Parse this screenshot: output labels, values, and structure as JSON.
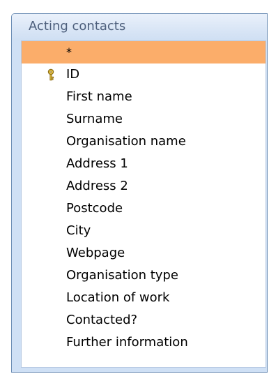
{
  "table": {
    "title": "Acting contacts",
    "fields": [
      {
        "label": "*",
        "selected": true,
        "primary_key": false
      },
      {
        "label": "ID",
        "selected": false,
        "primary_key": true
      },
      {
        "label": "First name",
        "selected": false,
        "primary_key": false
      },
      {
        "label": "Surname",
        "selected": false,
        "primary_key": false
      },
      {
        "label": "Organisation name",
        "selected": false,
        "primary_key": false
      },
      {
        "label": "Address 1",
        "selected": false,
        "primary_key": false
      },
      {
        "label": "Address 2",
        "selected": false,
        "primary_key": false
      },
      {
        "label": "Postcode",
        "selected": false,
        "primary_key": false
      },
      {
        "label": "City",
        "selected": false,
        "primary_key": false
      },
      {
        "label": "Webpage",
        "selected": false,
        "primary_key": false
      },
      {
        "label": "Organisation type",
        "selected": false,
        "primary_key": false
      },
      {
        "label": "Location of work",
        "selected": false,
        "primary_key": false
      },
      {
        "label": "Contacted?",
        "selected": false,
        "primary_key": false
      },
      {
        "label": "Further information",
        "selected": false,
        "primary_key": false
      }
    ],
    "key_icon": "key-icon"
  },
  "colors": {
    "selection": "#fbad6a",
    "header_text": "#4d5f7c",
    "frame_border": "#6e8fb6",
    "frame_fill": "#cfe0f5"
  }
}
